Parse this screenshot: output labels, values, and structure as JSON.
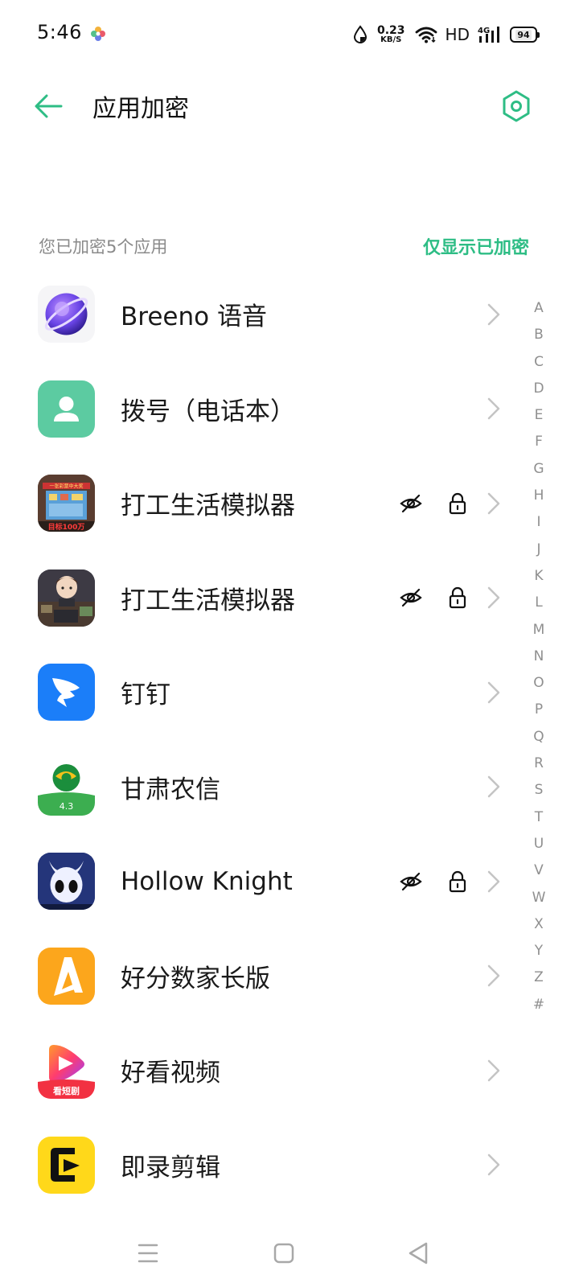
{
  "status_bar": {
    "time": "5:46",
    "net_speed_value": "0.23",
    "net_speed_unit": "KB/S",
    "hd_label": "HD",
    "network_type": "4G",
    "battery_level": "94"
  },
  "header": {
    "title": "应用加密",
    "back_icon": "arrow-left-icon",
    "settings_icon": "hexagon-gear-icon"
  },
  "summary": {
    "count_text": "您已加密5个应用",
    "filter_label": "仅显示已加密"
  },
  "apps": [
    {
      "name": "Breeno 语音",
      "hidden": false,
      "locked": false
    },
    {
      "name": "拨号（电话本）",
      "hidden": false,
      "locked": false
    },
    {
      "name": "打工生活模拟器",
      "hidden": true,
      "locked": true
    },
    {
      "name": "打工生活模拟器",
      "hidden": true,
      "locked": true
    },
    {
      "name": "钉钉",
      "hidden": false,
      "locked": false
    },
    {
      "name": "甘肃农信",
      "hidden": false,
      "locked": false,
      "icon_badge": "4.3"
    },
    {
      "name": "Hollow Knight",
      "hidden": true,
      "locked": true
    },
    {
      "name": "好分数家长版",
      "hidden": false,
      "locked": false
    },
    {
      "name": "好看视频",
      "hidden": false,
      "locked": false,
      "icon_badge": "看短剧"
    },
    {
      "name": "即录剪辑",
      "hidden": false,
      "locked": false
    }
  ],
  "icon_captions": {
    "work_sim_1_top": "一张彩票中大奖",
    "work_sim_1_bottom": "目标100万"
  },
  "index_letters": [
    "A",
    "B",
    "C",
    "D",
    "E",
    "F",
    "G",
    "H",
    "I",
    "J",
    "K",
    "L",
    "M",
    "N",
    "O",
    "P",
    "Q",
    "R",
    "S",
    "T",
    "U",
    "V",
    "W",
    "X",
    "Y",
    "Z",
    "#"
  ],
  "colors": {
    "accent": "#2ebd85",
    "text_primary": "#1a1a1a",
    "text_secondary": "#8a8a8a",
    "chevron": "#c4c4c4"
  },
  "nav_bar": {
    "menu_icon": "menu-icon",
    "home_icon": "home-square-icon",
    "back_icon": "back-triangle-icon"
  }
}
